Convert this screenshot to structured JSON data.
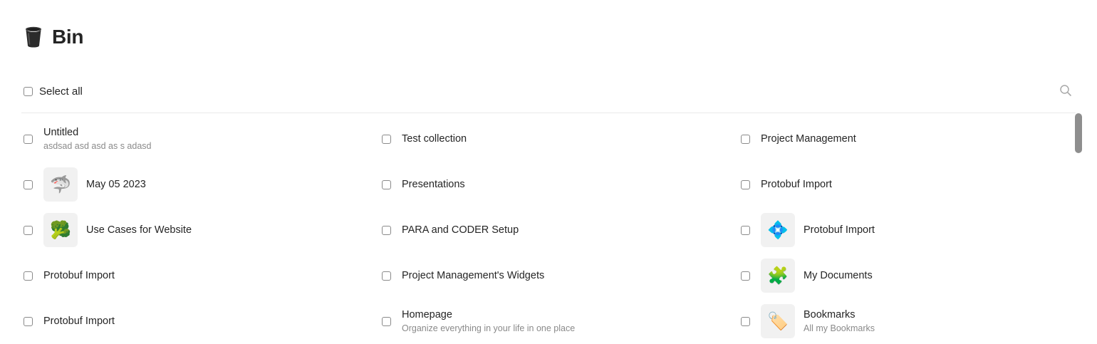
{
  "page": {
    "title": "Bin",
    "icon": "trash-bin-icon"
  },
  "toolbar": {
    "select_all_label": "Select all",
    "search_icon": "search-icon"
  },
  "columns": [
    [
      {
        "title": "Untitled",
        "subtitle": "asdsad asd asd as s adasd",
        "icon": null
      },
      {
        "title": "May 05 2023",
        "subtitle": null,
        "icon": "🦈"
      },
      {
        "title": "Use Cases for Website",
        "subtitle": null,
        "icon": "🥦"
      },
      {
        "title": "Protobuf Import",
        "subtitle": null,
        "icon": null
      },
      {
        "title": "Protobuf Import",
        "subtitle": null,
        "icon": null
      }
    ],
    [
      {
        "title": "Test collection",
        "subtitle": null,
        "icon": null
      },
      {
        "title": "Presentations",
        "subtitle": null,
        "icon": null
      },
      {
        "title": "PARA and CODER Setup",
        "subtitle": null,
        "icon": null
      },
      {
        "title": "Project Management's Widgets",
        "subtitle": null,
        "icon": null
      },
      {
        "title": "Homepage",
        "subtitle": "Organize everything in your life in one place",
        "icon": null
      }
    ],
    [
      {
        "title": "Project Management",
        "subtitle": null,
        "icon": null
      },
      {
        "title": "Protobuf Import",
        "subtitle": null,
        "icon": null
      },
      {
        "title": "Protobuf Import",
        "subtitle": null,
        "icon": "💠"
      },
      {
        "title": "My Documents",
        "subtitle": null,
        "icon": "🧩"
      },
      {
        "title": "Bookmarks",
        "subtitle": "All my Bookmarks",
        "icon": "🏷️"
      }
    ]
  ]
}
